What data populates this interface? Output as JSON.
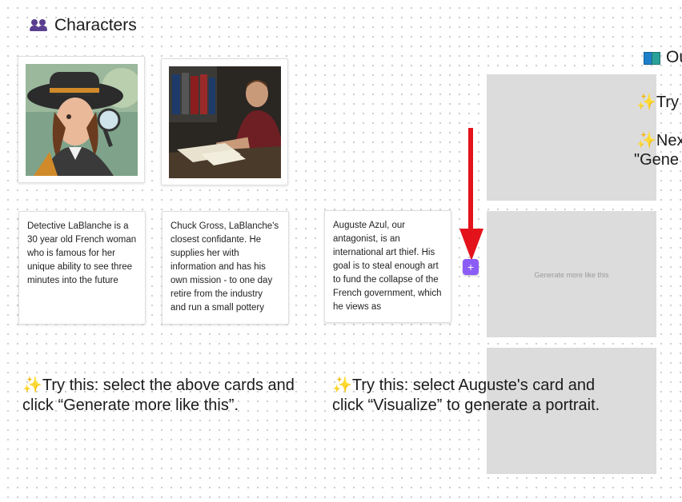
{
  "characters": {
    "title": "Characters",
    "icon": "people-icon"
  },
  "outline_partial": {
    "title": "Ou",
    "icon": "book-icon"
  },
  "cards": [
    {
      "text": "Detective LaBlanche is a 30 year old French woman who is famous for her unique ability to see three minutes into the future"
    },
    {
      "text": "Chuck Gross, LaBlanche's closest confidante. He supplies her with information and has his own mission - to one day retire from the industry and run a small pottery"
    },
    {
      "text": "Auguste Azul, our antagonist, is an international art thief. His goal is to steal enough art to fund the collapse of the French government, which he views as"
    }
  ],
  "tips": {
    "left": "Try this: select the above cards and click “Generate more like this”.",
    "middle": "Try this: select Auguste's card and click “Visualize” to generate a portrait.",
    "right_1": "Try",
    "right_2": "Nex",
    "right_3": "\"Gene"
  },
  "placeholder": {
    "label": "Generate more like this"
  },
  "plus_button": {
    "label": "+"
  },
  "colors": {
    "accent": "#8b5cf6",
    "arrow": "#e3121b",
    "placeholder": "#dcdcdc",
    "sparkle": "#f3b21c"
  }
}
